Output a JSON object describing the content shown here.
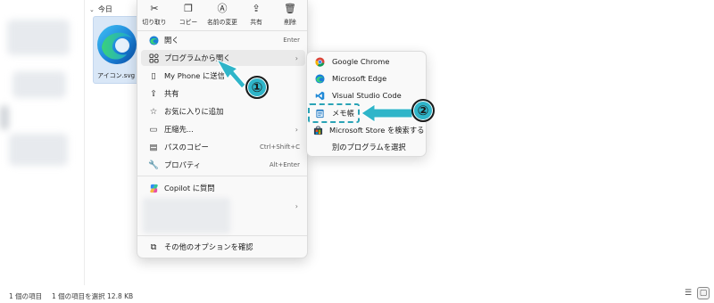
{
  "explorer": {
    "group_label": "今日",
    "file_name": "アイコン.svg",
    "status_count": "1 個の項目",
    "status_selected": "1 個の項目を選択 12.8 KB"
  },
  "quick_actions": [
    {
      "label": "切り取り",
      "icon": "scissors-icon"
    },
    {
      "label": "コピー",
      "icon": "copy-icon"
    },
    {
      "label": "名前の変更",
      "icon": "rename-icon"
    },
    {
      "label": "共有",
      "icon": "share-icon"
    },
    {
      "label": "削除",
      "icon": "trash-icon"
    }
  ],
  "context_menu": {
    "open": {
      "label": "開く",
      "shortcut": "Enter"
    },
    "open_with": {
      "label": "プログラムから開く"
    },
    "send_phone": {
      "label": "My Phone に送信"
    },
    "share": {
      "label": "共有"
    },
    "favorite": {
      "label": "お気に入りに追加"
    },
    "compress": {
      "label": "圧縮先..."
    },
    "copy_path": {
      "label": "パスのコピー",
      "shortcut": "Ctrl+Shift+C"
    },
    "properties": {
      "label": "プロパティ",
      "shortcut": "Alt+Enter"
    },
    "copilot": {
      "label": "Copilot に質問"
    },
    "more_options": {
      "label": "その他のオプションを確認"
    }
  },
  "submenu": {
    "items": [
      {
        "label": "Google Chrome",
        "icon": "chrome-icon"
      },
      {
        "label": "Microsoft Edge",
        "icon": "edge-icon"
      },
      {
        "label": "Visual Studio Code",
        "icon": "vscode-icon"
      },
      {
        "label": "メモ帳",
        "icon": "notepad-icon"
      },
      {
        "label": "Microsoft Store を検索する",
        "icon": "store-icon"
      },
      {
        "label": "別のプログラムを選択",
        "icon": ""
      }
    ]
  },
  "callouts": {
    "step1": "①",
    "step2": "②"
  },
  "colors": {
    "accent": "#2fb5c9",
    "menu_bg": "#f9f9f9",
    "selection": "#d9e7f7"
  }
}
